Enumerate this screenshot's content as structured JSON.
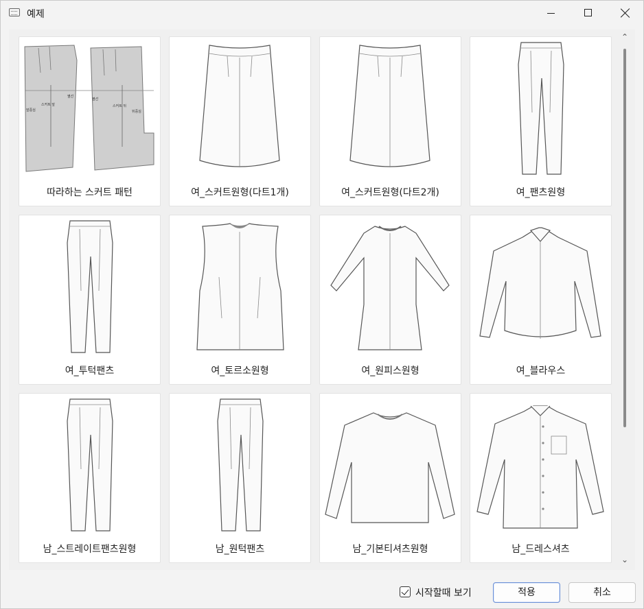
{
  "window": {
    "title": "예제"
  },
  "items": [
    {
      "label": "따라하는 스커트 패턴",
      "icon": "skirt-pattern"
    },
    {
      "label": "여_스커트원형(다트1개)",
      "icon": "skirt"
    },
    {
      "label": "여_스커트원형(다트2개)",
      "icon": "skirt"
    },
    {
      "label": "여_팬츠원형",
      "icon": "pants"
    },
    {
      "label": "여_투턱팬츠",
      "icon": "pants"
    },
    {
      "label": "여_토르소원형",
      "icon": "torso"
    },
    {
      "label": "여_원피스원형",
      "icon": "dress"
    },
    {
      "label": "여_블라우스",
      "icon": "blouse"
    },
    {
      "label": "남_스트레이트팬츠원형",
      "icon": "pants"
    },
    {
      "label": "남_원턱팬츠",
      "icon": "pants"
    },
    {
      "label": "남_기본티셔츠원형",
      "icon": "tshirt"
    },
    {
      "label": "남_드레스셔츠",
      "icon": "dress-shirt"
    }
  ],
  "pattern_annotations": [
    "앞중심",
    "스커트 앞",
    "옆선",
    "옆선",
    "스커트 뒤",
    "뒤중심"
  ],
  "footer": {
    "show_on_start_label": "시작할때 보기",
    "show_on_start_checked": true,
    "apply_label": "적용",
    "cancel_label": "취소"
  }
}
